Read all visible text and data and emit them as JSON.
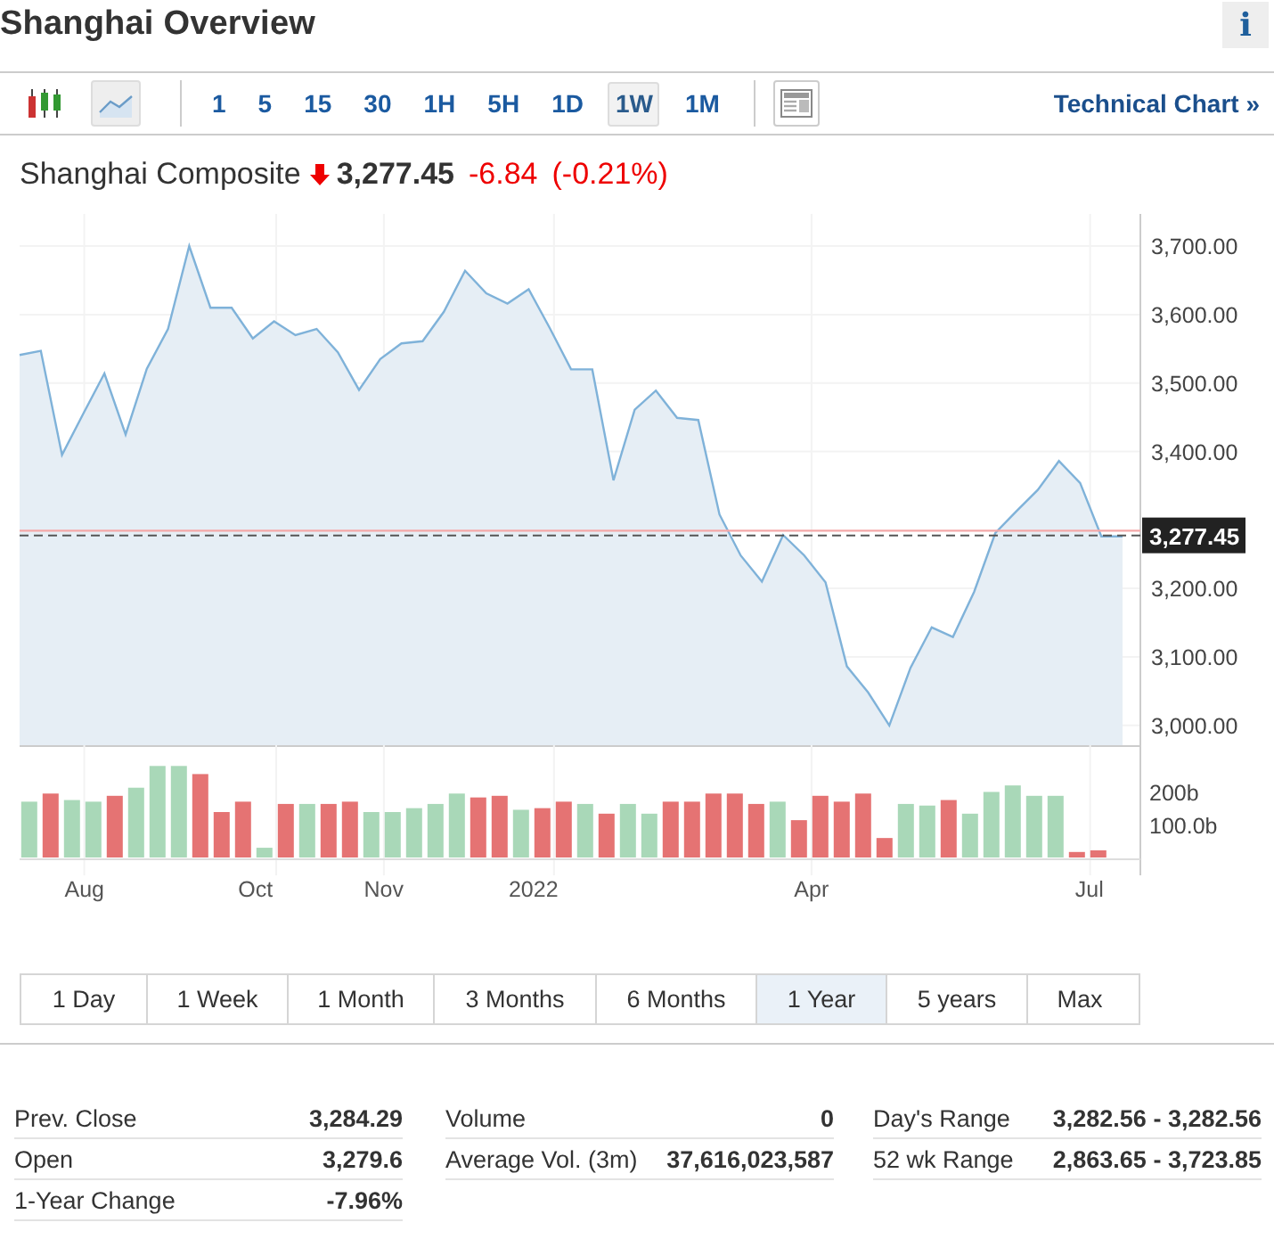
{
  "header": {
    "title": "Shanghai Overview",
    "info": "i"
  },
  "toolbar": {
    "chart_types": [
      {
        "kind": "candles",
        "selected": false
      },
      {
        "kind": "area",
        "selected": true
      }
    ],
    "intervals": [
      {
        "label": "1",
        "selected": false
      },
      {
        "label": "5",
        "selected": false
      },
      {
        "label": "15",
        "selected": false
      },
      {
        "label": "30",
        "selected": false
      },
      {
        "label": "1H",
        "selected": false
      },
      {
        "label": "5H",
        "selected": false
      },
      {
        "label": "1D",
        "selected": false
      },
      {
        "label": "1W",
        "selected": true
      },
      {
        "label": "1M",
        "selected": false
      }
    ],
    "link": "Technical Chart »"
  },
  "quote": {
    "name": "Shanghai Composite",
    "falling": true,
    "price": "3,277.45",
    "change": "-6.84",
    "change_pct": "(-0.21%)"
  },
  "price_chart": {
    "chart_data": {
      "type": "area",
      "grid": true,
      "ylim": [
        2971,
        3747
      ],
      "series": [
        {
          "color": "#7fb2d9",
          "values": [
            3541,
            3547,
            3395,
            3455,
            3514,
            3425,
            3521,
            3579,
            3700,
            3610,
            3610,
            3565,
            3590,
            3570,
            3579,
            3545,
            3490,
            3535,
            3558,
            3561,
            3604,
            3664,
            3631,
            3616,
            3637,
            3580,
            3520,
            3520,
            3358,
            3461,
            3489,
            3449,
            3446,
            3308,
            3248,
            3210,
            3278,
            3248,
            3209,
            3086,
            3048,
            3000,
            3084,
            3143,
            3129,
            3195,
            3281,
            3313,
            3344,
            3386,
            3354,
            3276,
            3276
          ]
        }
      ],
      "yticks": [
        {
          "value": 3000,
          "label": "3,000.00"
        },
        {
          "value": 3100,
          "label": "3,100.00"
        },
        {
          "value": 3200,
          "label": "3,200.00"
        },
        {
          "value": 3400,
          "label": "3,400.00"
        },
        {
          "value": 3500,
          "label": "3,500.00"
        },
        {
          "value": 3600,
          "label": "3,600.00"
        },
        {
          "value": 3700,
          "label": "3,700.00"
        }
      ],
      "ref_lines": [
        {
          "axis": "y",
          "value": 3284.29,
          "color": "#f4a8a8"
        },
        {
          "axis": "y",
          "value": 3277.45,
          "color": "#555555",
          "label": "3,277.45"
        }
      ]
    }
  },
  "volume_chart": {
    "chart_data": {
      "type": "bar",
      "grid": true,
      "ylim": [
        0,
        346
      ],
      "categories": [
        null,
        null,
        null,
        "Aug",
        null,
        null,
        null,
        null,
        null,
        null,
        null,
        "Oct",
        null,
        null,
        null,
        null,
        null,
        "Nov",
        null,
        null,
        null,
        null,
        null,
        null,
        "2022",
        null,
        null,
        null,
        null,
        null,
        null,
        null,
        null,
        null,
        null,
        null,
        null,
        "Apr",
        null,
        null,
        null,
        null,
        null,
        null,
        null,
        null,
        null,
        null,
        null,
        null,
        "Jul"
      ],
      "series": [
        {
          "color": "#a9d8b8",
          "values": [
            172,
            null,
            177,
            172,
            null,
            215,
            282,
            282,
            null,
            null,
            null,
            30,
            null,
            165,
            null,
            null,
            140,
            140,
            152,
            165,
            197,
            null,
            null,
            147,
            null,
            null,
            165,
            null,
            165,
            135,
            null,
            null,
            null,
            null,
            null,
            172,
            null,
            null,
            null,
            null,
            null,
            165,
            160,
            null,
            135,
            202,
            222,
            190,
            190,
            null,
            null
          ]
        },
        {
          "color": "#e57373",
          "values": [
            null,
            197,
            null,
            null,
            190,
            null,
            null,
            null,
            257,
            140,
            172,
            null,
            165,
            null,
            165,
            172,
            null,
            null,
            null,
            null,
            null,
            185,
            190,
            null,
            152,
            172,
            null,
            135,
            null,
            null,
            172,
            172,
            197,
            197,
            165,
            null,
            115,
            190,
            172,
            197,
            60,
            null,
            null,
            177,
            null,
            null,
            null,
            null,
            null,
            17,
            22
          ]
        }
      ],
      "yticks": [
        {
          "value": 100,
          "label": "100.0b"
        },
        {
          "value": 200,
          "label": "200b"
        }
      ]
    }
  },
  "ranges": [
    {
      "label": "1 Day",
      "selected": false
    },
    {
      "label": "1 Week",
      "selected": false
    },
    {
      "label": "1 Month",
      "selected": false
    },
    {
      "label": "3 Months",
      "selected": false
    },
    {
      "label": "6 Months",
      "selected": false
    },
    {
      "label": "1 Year",
      "selected": true
    },
    {
      "label": "5 years",
      "selected": false
    },
    {
      "label": "Max",
      "selected": false
    }
  ],
  "stats": [
    [
      {
        "label": "Prev. Close",
        "value": "3,284.29"
      },
      {
        "label": "Open",
        "value": "3,279.6"
      },
      {
        "label": "1-Year Change",
        "value": "-7.96%"
      }
    ],
    [
      {
        "label": "Volume",
        "value": "0"
      },
      {
        "label": "Average Vol. (3m)",
        "value": "37,616,023,587"
      }
    ],
    [
      {
        "label": "Day's Range",
        "value": "3,282.56 - 3,282.56"
      },
      {
        "label": "52 wk Range",
        "value": "2,863.65 - 3,723.85"
      }
    ]
  ]
}
